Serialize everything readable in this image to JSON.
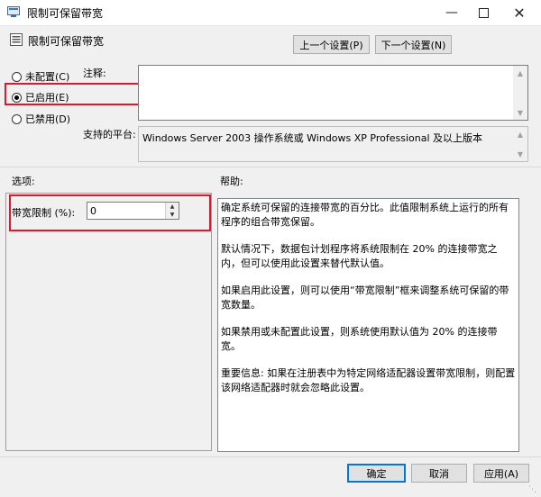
{
  "window": {
    "title": "限制可保留带宽"
  },
  "header": {
    "title": "限制可保留带宽",
    "prev_button": "上一个设置(P)",
    "next_button": "下一个设置(N)"
  },
  "state": {
    "not_configured": "未配置(C)",
    "enabled": "已启用(E)",
    "disabled": "已禁用(D)",
    "selected": "enabled"
  },
  "comment": {
    "label": "注释:",
    "value": ""
  },
  "platform": {
    "label": "支持的平台:",
    "value": "Windows Server 2003 操作系统或 Windows XP Professional 及以上版本"
  },
  "options": {
    "heading": "选项:",
    "bandwidth_label": "带宽限制 (%):",
    "bandwidth_value": "0"
  },
  "help": {
    "heading": "帮助:",
    "paragraphs": [
      "确定系统可保留的连接带宽的百分比。此值限制系统上运行的所有程序的组合带宽保留。",
      "默认情况下，数据包计划程序将系统限制在 20% 的连接带宽之内，但可以使用此设置来替代默认值。",
      "如果启用此设置，则可以使用“带宽限制”框来调整系统可保留的带宽数量。",
      "如果禁用或未配置此设置，则系统使用默认值为 20% 的连接带宽。",
      "重要信息: 如果在注册表中为特定网络适配器设置带宽限制，则配置该网络适配器时就会忽略此设置。"
    ]
  },
  "footer": {
    "ok": "确定",
    "cancel": "取消",
    "apply": "应用(A)"
  },
  "colors": {
    "highlight_box": "#e0162b",
    "focus_border": "#0078d7"
  }
}
